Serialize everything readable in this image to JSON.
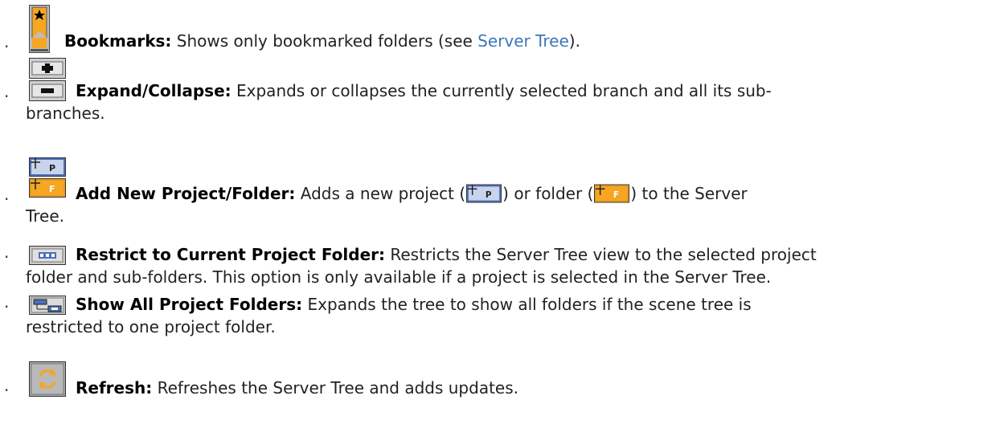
{
  "items": [
    {
      "name": "bookmarks",
      "term": "Bookmarks:",
      "text_a": " Shows only bookmarked folders (see ",
      "link": "Server Tree",
      "text_b": ")."
    },
    {
      "name": "expand-collapse",
      "term": "Expand/Collapse:",
      "text_a": " Expands or collapses the currently selected branch and all its sub-",
      "text_b": "branches."
    },
    {
      "name": "add-new-project-folder",
      "term": "Add New Project/Folder:",
      "text_a": " Adds a new project (",
      "text_b": ") or folder (",
      "text_c": ") to the Server",
      "text_d": "Tree."
    },
    {
      "name": "restrict-to-current-project-folder",
      "term": "Restrict to Current Project Folder:",
      "text_a": " Restricts the Server Tree view to the selected project",
      "text_b": "folder and sub-folders. This option is only available if a project is selected in the Server Tree."
    },
    {
      "name": "show-all-project-folders",
      "term": "Show All Project Folders:",
      "text_a": " Expands the tree to show all folders if the scene tree is",
      "text_b": "restricted to one project folder."
    },
    {
      "name": "refresh",
      "term": "Refresh:",
      "text_a": " Refreshes the Server Tree and adds updates."
    }
  ],
  "bullet": "·",
  "icon_labels": {
    "project": "P",
    "folder": "F",
    "plus": "+",
    "minus": "−"
  },
  "colors": {
    "orange": "#f5a623",
    "gray": "#a9a9a9",
    "link": "#3a78b8",
    "blue": "#3b5fae"
  }
}
